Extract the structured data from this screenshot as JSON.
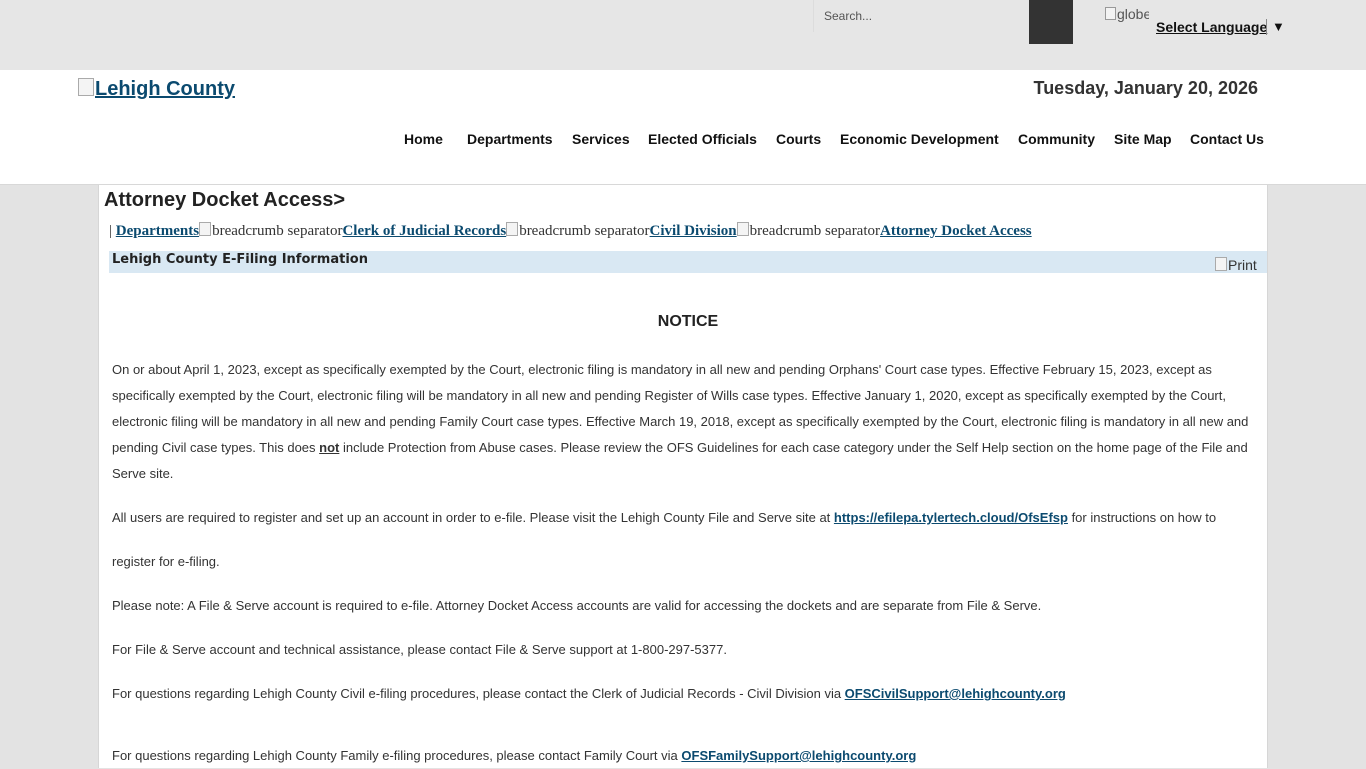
{
  "topbar": {
    "search_placeholder": "Search...",
    "globe_alt": "globe",
    "language_label": "Select Language",
    "language_arrow": "▼"
  },
  "header": {
    "logo_text": "Lehigh County",
    "date": "Tuesday, January 20, 2026",
    "nav": [
      "Home",
      "Departments",
      "Services",
      "Elected Officials",
      "Courts",
      "Economic Development",
      "Community",
      "Site Map",
      "Contact Us"
    ]
  },
  "page": {
    "title": "Attorney Docket Access>",
    "breadcrumb": {
      "prefix": "| ",
      "separator_alt": "breadcrumb separator",
      "items": [
        "Departments",
        "Clerk of Judicial Records",
        "Civil Division",
        "Attorney Docket Access"
      ]
    },
    "info_title": "Lehigh County E-Filing Information",
    "print_label": "Print"
  },
  "body": {
    "notice": "NOTICE",
    "p1_a": "On or about April 1, 2023, except as specifically exempted by the Court, electronic filing is mandatory in all new and pending Orphans' Court case types.  Effective February 15, 2023, except as specifically exempted by the Court, electronic filing will be mandatory in all new and pending Register of Wills case types.  Effective January 1, 2020, except as specifically exempted by the Court, electronic filing will be mandatory in all new and pending Family Court case types.  Effective March 19, 2018, except as specifically exempted by the Court, electronic filing is mandatory in all new and pending Civil case types.  This does ",
    "p1_not": "not",
    "p1_b": " include Protection from Abuse cases.  Please review the OFS Guidelines for each case category under the Self Help section on the home page of the File and Serve site.",
    "p2_a": "All users are required to register and set up an account in order to e-file.  Please visit the Lehigh County File and Serve site at ",
    "p2_link": "https://efilepa.tylertech.cloud/OfsEfsp",
    "p2_b": " for instructions on how to",
    "p2_c": "register for e-filing.",
    "p3": "Please note:  A File & Serve account is required to e-file.  Attorney Docket Access accounts are valid for accessing the dockets and are separate from File & Serve.",
    "p4": "For File & Serve account and technical assistance, please contact File & Serve support at 1-800-297-5377.",
    "p5_a": "For questions regarding Lehigh County Civil e-filing procedures, please contact the Clerk of Judicial Records - Civil Division via ",
    "p5_link": "OFSCivilSupport@lehighcounty.org",
    "p6_a": "For questions regarding Lehigh County Family e-filing procedures, please contact Family Court via ",
    "p6_link": "OFSFamilySupport@lehighcounty.org"
  }
}
